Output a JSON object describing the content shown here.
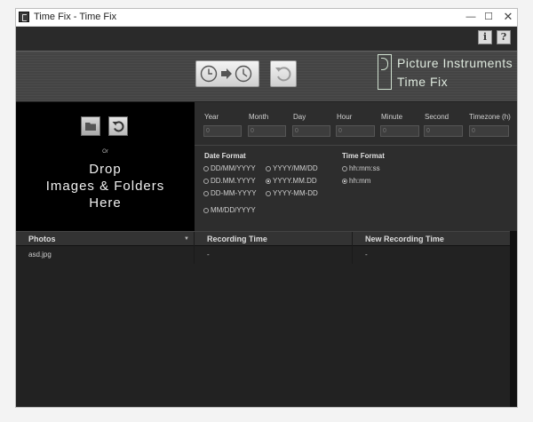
{
  "window": {
    "title": "Time Fix - Time Fix",
    "min_icon": "—",
    "max_icon": "☐",
    "close_icon": "✕"
  },
  "help": {
    "info_label": "i",
    "help_label": "?"
  },
  "logo": {
    "line1": "Picture Instruments",
    "line2": "Time Fix"
  },
  "dropzone": {
    "or": "Or",
    "text": "Drop\nImages & Folders\nHere"
  },
  "fields": [
    {
      "label": "Year",
      "placeholder": "0"
    },
    {
      "label": "Month",
      "placeholder": "0"
    },
    {
      "label": "Day",
      "placeholder": "0"
    },
    {
      "label": "Hour",
      "placeholder": "0"
    },
    {
      "label": "Minute",
      "placeholder": "0"
    },
    {
      "label": "Second",
      "placeholder": "0"
    },
    {
      "label": "Timezone (h)",
      "placeholder": "0"
    }
  ],
  "date_format": {
    "heading": "Date Format",
    "options": [
      "DD/MM/YYYY",
      "YYYY/MM/DD",
      "DD.MM.YYYY",
      "YYYY.MM.DD",
      "DD-MM-YYYY",
      "YYYY-MM-DD",
      "MM/DD/YYYY"
    ],
    "selected": "YYYY.MM.DD"
  },
  "time_format": {
    "heading": "Time Format",
    "options": [
      "hh:mm:ss",
      "hh:mm"
    ],
    "selected": "hh:mm"
  },
  "table": {
    "columns": [
      "Photos",
      "Recording Time",
      "New Recording Time"
    ],
    "rows": [
      {
        "photo": "asd.jpg",
        "recording": "-",
        "new_recording": "-"
      }
    ]
  },
  "colors": {
    "background": "#2d2d2d",
    "dropzone": "#000000",
    "accent_text": "#dde8dd"
  }
}
